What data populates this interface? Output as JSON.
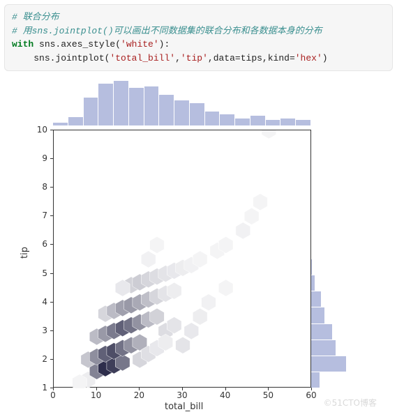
{
  "code": {
    "comment1": "# 联合分布",
    "comment2": "# 用sns.jointplot()可以画出不同数据集的联合分布和各数据本身的分布",
    "kw_with": "with",
    "sns_axes": " sns.axes_style(",
    "white": "'white'",
    "close_with": "):",
    "indent": "    ",
    "jointplot": "sns.jointplot(",
    "arg1": "'total_bill'",
    "comma1": ",",
    "arg2": "'tip'",
    "comma2": ",data",
    "eq1": "=",
    "tips": "tips,kind",
    "eq2": "=",
    "hex": "'hex'",
    "close": ")"
  },
  "chart_data": {
    "type": "hexbin-jointplot",
    "title": "",
    "xlabel": "total_bill",
    "ylabel": "tip",
    "xlim": [
      0,
      60
    ],
    "ylim": [
      1,
      10
    ],
    "x_ticks": [
      0,
      10,
      20,
      30,
      40,
      50,
      60
    ],
    "y_ticks": [
      1,
      2,
      3,
      4,
      5,
      6,
      7,
      8,
      9,
      10
    ],
    "top_hist": {
      "bin_edges": [
        3,
        6,
        9,
        12,
        15,
        18,
        21,
        24,
        27,
        30,
        33,
        36,
        39,
        42,
        45,
        48,
        51
      ],
      "counts": [
        2,
        6,
        20,
        30,
        32,
        27,
        28,
        22,
        18,
        16,
        10,
        8,
        5,
        7,
        4,
        5,
        4
      ]
    },
    "right_hist": {
      "bin_edges": [
        1.0,
        1.6,
        2.2,
        2.8,
        3.4,
        4.0,
        4.6,
        5.2,
        5.8,
        6.4,
        7.0,
        7.6,
        8.2,
        8.8,
        9.4,
        10.0
      ],
      "counts": [
        20,
        50,
        38,
        34,
        26,
        22,
        15,
        12,
        5,
        4,
        2,
        0,
        0,
        0,
        1,
        1
      ]
    },
    "hex_cells": [
      {
        "x": 8,
        "y": 1.3,
        "d": 0.08
      },
      {
        "x": 10,
        "y": 1.6,
        "d": 0.55
      },
      {
        "x": 12,
        "y": 1.7,
        "d": 0.92
      },
      {
        "x": 14,
        "y": 1.8,
        "d": 0.85
      },
      {
        "x": 16,
        "y": 1.9,
        "d": 0.6
      },
      {
        "x": 8,
        "y": 2.0,
        "d": 0.25
      },
      {
        "x": 10,
        "y": 2.1,
        "d": 0.5
      },
      {
        "x": 12,
        "y": 2.2,
        "d": 0.7
      },
      {
        "x": 14,
        "y": 2.3,
        "d": 0.78
      },
      {
        "x": 16,
        "y": 2.4,
        "d": 0.62
      },
      {
        "x": 18,
        "y": 2.5,
        "d": 0.48
      },
      {
        "x": 20,
        "y": 2.6,
        "d": 0.35
      },
      {
        "x": 10,
        "y": 2.8,
        "d": 0.3
      },
      {
        "x": 12,
        "y": 2.9,
        "d": 0.45
      },
      {
        "x": 14,
        "y": 3.0,
        "d": 0.58
      },
      {
        "x": 16,
        "y": 3.1,
        "d": 0.7
      },
      {
        "x": 18,
        "y": 3.2,
        "d": 0.62
      },
      {
        "x": 20,
        "y": 3.3,
        "d": 0.48
      },
      {
        "x": 22,
        "y": 3.4,
        "d": 0.3
      },
      {
        "x": 24,
        "y": 3.5,
        "d": 0.2
      },
      {
        "x": 12,
        "y": 3.6,
        "d": 0.18
      },
      {
        "x": 14,
        "y": 3.7,
        "d": 0.3
      },
      {
        "x": 16,
        "y": 3.8,
        "d": 0.42
      },
      {
        "x": 18,
        "y": 3.9,
        "d": 0.45
      },
      {
        "x": 20,
        "y": 4.0,
        "d": 0.38
      },
      {
        "x": 22,
        "y": 4.1,
        "d": 0.28
      },
      {
        "x": 24,
        "y": 4.2,
        "d": 0.18
      },
      {
        "x": 26,
        "y": 4.3,
        "d": 0.12
      },
      {
        "x": 28,
        "y": 4.4,
        "d": 0.08
      },
      {
        "x": 18,
        "y": 4.6,
        "d": 0.2
      },
      {
        "x": 20,
        "y": 4.7,
        "d": 0.22
      },
      {
        "x": 22,
        "y": 4.8,
        "d": 0.18
      },
      {
        "x": 24,
        "y": 4.9,
        "d": 0.15
      },
      {
        "x": 26,
        "y": 5.0,
        "d": 0.12
      },
      {
        "x": 28,
        "y": 5.1,
        "d": 0.1
      },
      {
        "x": 30,
        "y": 5.2,
        "d": 0.08
      },
      {
        "x": 32,
        "y": 5.3,
        "d": 0.06
      },
      {
        "x": 34,
        "y": 5.5,
        "d": 0.05
      },
      {
        "x": 38,
        "y": 5.8,
        "d": 0.05
      },
      {
        "x": 40,
        "y": 6.0,
        "d": 0.05
      },
      {
        "x": 44,
        "y": 6.5,
        "d": 0.06
      },
      {
        "x": 46,
        "y": 7.0,
        "d": 0.05
      },
      {
        "x": 48,
        "y": 7.5,
        "d": 0.05
      },
      {
        "x": 50,
        "y": 10.0,
        "d": 0.05
      },
      {
        "x": 30,
        "y": 2.5,
        "d": 0.12
      },
      {
        "x": 32,
        "y": 3.0,
        "d": 0.1
      },
      {
        "x": 34,
        "y": 3.5,
        "d": 0.08
      },
      {
        "x": 36,
        "y": 4.0,
        "d": 0.06
      },
      {
        "x": 40,
        "y": 4.5,
        "d": 0.05
      },
      {
        "x": 6,
        "y": 1.2,
        "d": 0.05
      },
      {
        "x": 26,
        "y": 3.0,
        "d": 0.15
      },
      {
        "x": 28,
        "y": 3.2,
        "d": 0.12
      },
      {
        "x": 16,
        "y": 4.5,
        "d": 0.1
      },
      {
        "x": 22,
        "y": 5.5,
        "d": 0.06
      },
      {
        "x": 24,
        "y": 6.0,
        "d": 0.05
      },
      {
        "x": 20,
        "y": 2.0,
        "d": 0.18
      },
      {
        "x": 22,
        "y": 2.2,
        "d": 0.14
      },
      {
        "x": 24,
        "y": 2.4,
        "d": 0.1
      },
      {
        "x": 26,
        "y": 2.6,
        "d": 0.08
      }
    ]
  },
  "watermark": "©51CTO博客"
}
